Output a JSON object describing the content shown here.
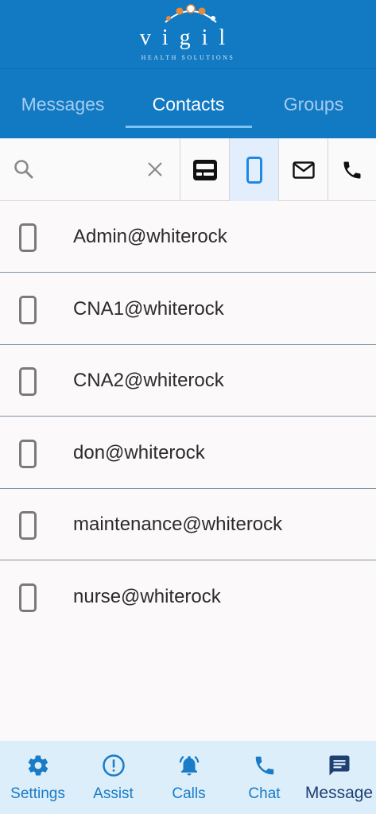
{
  "header": {
    "logo_word": "vigil",
    "logo_sub": "HEALTH SOLUTIONS"
  },
  "tabs": [
    {
      "label": "Messages",
      "active": false
    },
    {
      "label": "Contacts",
      "active": true
    },
    {
      "label": "Groups",
      "active": false
    }
  ],
  "search": {
    "value": "",
    "placeholder": ""
  },
  "filters": [
    {
      "icon": "pager-icon",
      "active": false
    },
    {
      "icon": "mobile-phone-icon",
      "active": true
    },
    {
      "icon": "email-icon",
      "active": false
    },
    {
      "icon": "phone-icon",
      "active": false
    }
  ],
  "contacts": [
    {
      "name": "Admin@whiterock",
      "icon": "mobile-phone-icon"
    },
    {
      "name": "CNA1@whiterock",
      "icon": "mobile-phone-icon"
    },
    {
      "name": "CNA2@whiterock",
      "icon": "mobile-phone-icon"
    },
    {
      "name": "don@whiterock",
      "icon": "mobile-phone-icon"
    },
    {
      "name": "maintenance@whiterock",
      "icon": "mobile-phone-icon"
    },
    {
      "name": "nurse@whiterock",
      "icon": "mobile-phone-icon"
    }
  ],
  "bottom_nav": [
    {
      "label": "Settings",
      "icon": "gear-icon",
      "active": false
    },
    {
      "label": "Assist",
      "icon": "alert-circle-icon",
      "active": false
    },
    {
      "label": "Calls",
      "icon": "bell-icon",
      "active": false
    },
    {
      "label": "Chat",
      "icon": "phone-icon",
      "active": false
    },
    {
      "label": "Message",
      "icon": "message-icon",
      "active": true
    }
  ],
  "colors": {
    "header_bg": "#1279c3",
    "tab_inactive": "#a6cdef",
    "tab_active": "#ffffff",
    "accent": "#1a7bc7",
    "active_nav": "#1f3e72",
    "bottom_nav_bg": "#dbeefa"
  }
}
